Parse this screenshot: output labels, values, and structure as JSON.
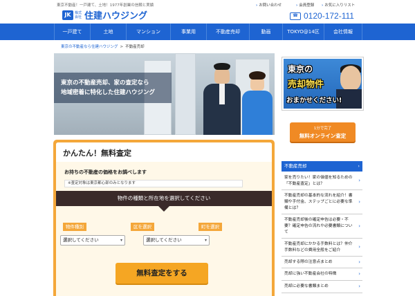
{
  "header": {
    "tagline": "東京不動産！一戸建て、土地！1977年創業の信頼と実績",
    "logo_mark": "JK",
    "logo_kabushiki": "株式会社",
    "logo_name": "住建ハウジング",
    "util_links": [
      "お問い合わせ",
      "会員登録",
      "お気に入りリスト"
    ],
    "phone": "0120-172-111",
    "phone_icon": "phone-icon"
  },
  "nav": {
    "items": [
      "一戸建て",
      "土地",
      "マンション",
      "事業用",
      "不動産売却",
      "動画",
      "TOKYO@14区",
      "会社情報"
    ]
  },
  "breadcrumb": {
    "home": "東京の不動産なら住建ハウジング",
    "current": "不動産売却"
  },
  "hero": {
    "line1": "東京の不動産売却、家の査定なら",
    "line2": "地域密着に特化した住建ハウジング"
  },
  "form": {
    "title": "かんたん！無料査定",
    "subtitle": "お持ちの不動産の価格をお調べします",
    "note": "※査定対象は東京都心部のみとなります",
    "bar_text": "物件の種類と所在地を選択してください",
    "labels": [
      "物件種別",
      "区を選択",
      "町を選択"
    ],
    "selects": [
      "選択してください",
      "選択してください"
    ],
    "submit": "無料査定をする"
  },
  "sidebar": {
    "promo_line1": "東京の",
    "promo_line2": "売却物件",
    "promo_line3": "おまかせください!",
    "cta_small": "1分で完了",
    "cta_main": "無料オンライン査定",
    "section_title": "不動産売却",
    "items": [
      "家を売りたい！家の価値を知るための「不動産査定」とは？",
      "不動産売却の基本的な流れを紹介！書類や手付金、ステップごとに必要な準備とは？",
      "不動産売却後の確定申告は必要・不要？確定申告の流れや必要書類について",
      "不動産売却にかかる手数料とは？仲介手数料などの費用全般をご紹介",
      "売却する際の注意点まとめ",
      "売却に強い不動産会社の特徴",
      "売却に必要な書類まとめ"
    ]
  },
  "colors": {
    "brand_blue": "#1e64d2",
    "orange": "#f4a73a",
    "dark_bar": "#3a2a2a"
  }
}
